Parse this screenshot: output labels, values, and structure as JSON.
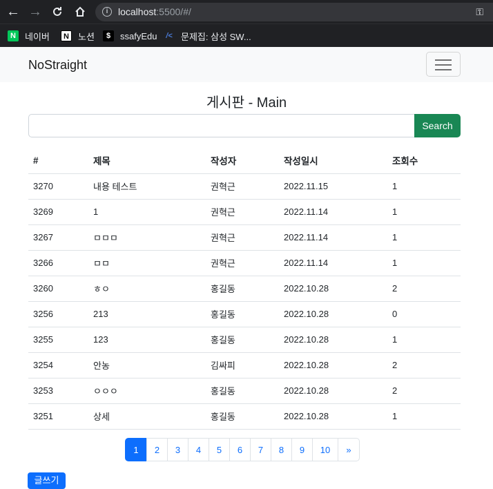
{
  "browser": {
    "url_host": "localhost",
    "url_rest": ":5500/#/",
    "bookmarks": [
      {
        "label": "네이버",
        "icon": "naver-icon"
      },
      {
        "label": "노션",
        "icon": "notion-icon"
      },
      {
        "label": "ssafyEdu",
        "icon": "ssafy-icon"
      },
      {
        "label": "문제집: 삼성 SW...",
        "icon": "swea-icon"
      }
    ]
  },
  "navbar": {
    "brand": "NoStraight"
  },
  "page_title": "게시판 - Main",
  "search": {
    "value": "",
    "button_label": "Search"
  },
  "table": {
    "headers": [
      "#",
      "제목",
      "작성자",
      "작성일시",
      "조회수"
    ],
    "rows": [
      [
        "3270",
        "내용 테스트",
        "권혁근",
        "2022.11.15",
        "1"
      ],
      [
        "3269",
        "1",
        "권혁근",
        "2022.11.14",
        "1"
      ],
      [
        "3267",
        "ㅁㅁㅁ",
        "권혁근",
        "2022.11.14",
        "1"
      ],
      [
        "3266",
        "ㅁㅁ",
        "권혁근",
        "2022.11.14",
        "1"
      ],
      [
        "3260",
        "ㅎㅇ",
        "홍길동",
        "2022.10.28",
        "2"
      ],
      [
        "3256",
        "213",
        "홍길동",
        "2022.10.28",
        "0"
      ],
      [
        "3255",
        "123",
        "홍길동",
        "2022.10.28",
        "1"
      ],
      [
        "3254",
        "안농",
        "김싸피",
        "2022.10.28",
        "2"
      ],
      [
        "3253",
        "ㅇㅇㅇ",
        "홍길동",
        "2022.10.28",
        "2"
      ],
      [
        "3251",
        "상세",
        "홍길동",
        "2022.10.28",
        "1"
      ]
    ]
  },
  "pagination": {
    "pages": [
      "1",
      "2",
      "3",
      "4",
      "5",
      "6",
      "7",
      "8",
      "9",
      "10"
    ],
    "active": "1",
    "next": "»"
  },
  "write_button": "글쓰기",
  "colors": {
    "primary": "#0d6efd",
    "success": "#198754"
  }
}
